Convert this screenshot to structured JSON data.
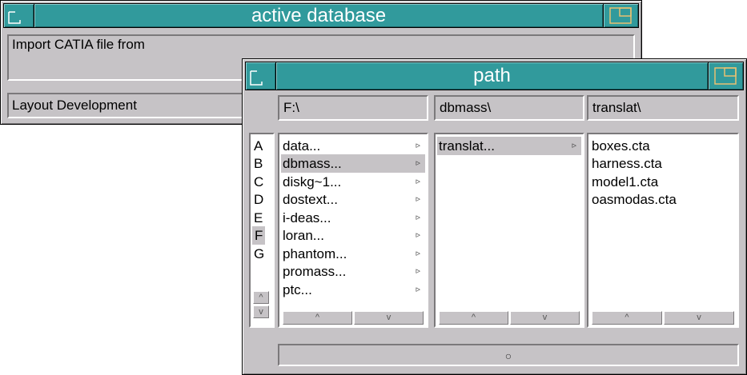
{
  "active_database": {
    "title": "active database",
    "description": "Import CATIA file from",
    "status": "Layout Development"
  },
  "path_window": {
    "title": "path",
    "columns": [
      {
        "path": "F:\\",
        "items": [
          {
            "label": "data...",
            "arrow": "▹"
          },
          {
            "label": "dbmass...",
            "arrow": "▹",
            "selected": true
          },
          {
            "label": "diskg~1...",
            "arrow": "▹"
          },
          {
            "label": "dostext...",
            "arrow": "▹"
          },
          {
            "label": "i-deas...",
            "arrow": "▹"
          },
          {
            "label": "loran...",
            "arrow": "▹"
          },
          {
            "label": "phantom...",
            "arrow": "▹"
          },
          {
            "label": "promass...",
            "arrow": "▹"
          },
          {
            "label": "ptc...",
            "arrow": "▹"
          }
        ]
      },
      {
        "path": "dbmass\\",
        "items": [
          {
            "label": "translat...",
            "arrow": "▹",
            "selected": true
          }
        ]
      },
      {
        "path": "translat\\",
        "items": [
          {
            "label": "boxes.cta"
          },
          {
            "label": "harness.cta"
          },
          {
            "label": "model1.cta"
          },
          {
            "label": "oasmodas.cta"
          }
        ]
      }
    ],
    "drives": [
      "A",
      "B",
      "C",
      "D",
      "E",
      "F",
      "G"
    ],
    "selected_drive": "F",
    "scroll_up": "^",
    "scroll_down": "v",
    "ok_glyph": "○"
  },
  "colors": {
    "titlebar": "#319a9c",
    "panel": "#c6c3c6"
  }
}
